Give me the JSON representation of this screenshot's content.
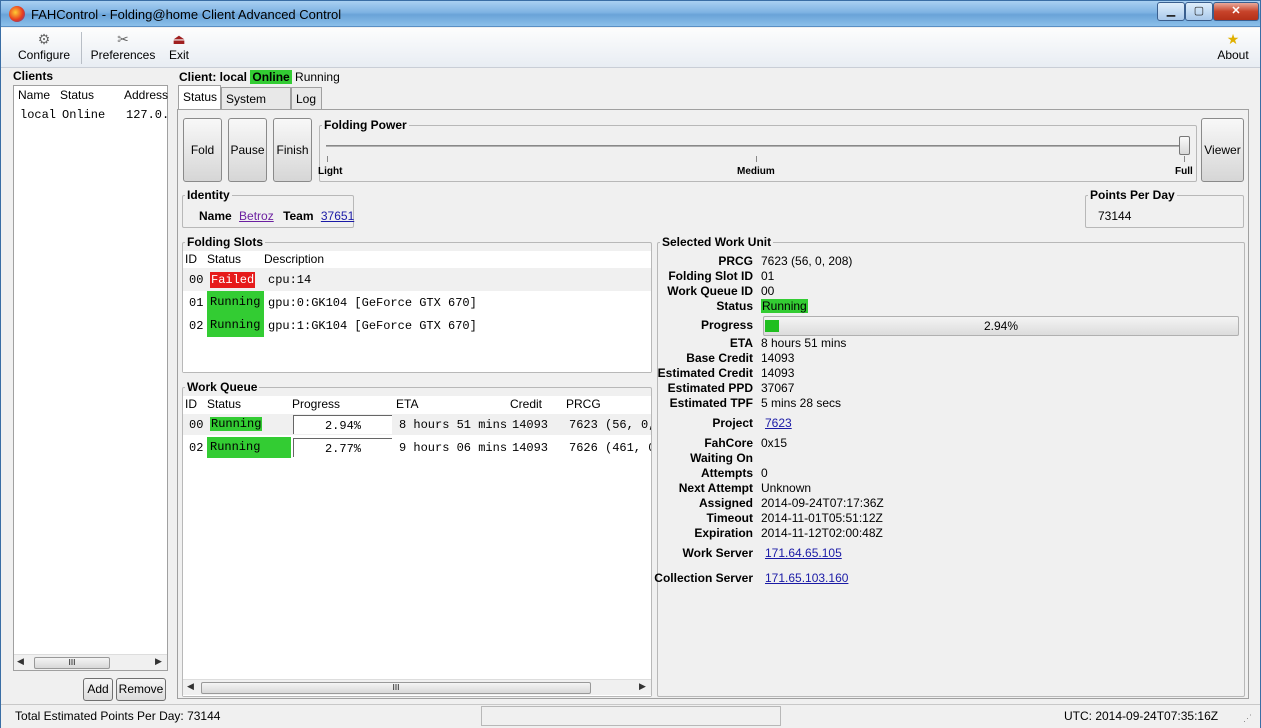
{
  "window": {
    "title": "FAHControl - Folding@home Client Advanced Control",
    "min_glyph": "▁",
    "max_glyph": "▢",
    "close_glyph": "✕"
  },
  "toolbar": {
    "configure": "Configure",
    "preferences": "Preferences",
    "exit": "Exit",
    "about": "About"
  },
  "clients": {
    "label": "Clients",
    "columns": [
      "Name",
      "Status",
      "Address"
    ],
    "rows": [
      {
        "name": "local",
        "status": "Online",
        "address": "127.0."
      }
    ],
    "scroll_glyph": "III",
    "add": "Add",
    "remove": "Remove"
  },
  "client_header": {
    "prefix": "Client: local",
    "online": "Online",
    "status": "Running"
  },
  "tabs": [
    "Status",
    "System Info",
    "Log"
  ],
  "controls": {
    "fold": "Fold",
    "pause": "Pause",
    "finish": "Finish",
    "viewer": "Viewer",
    "folding_power_label": "Folding Power",
    "light": "Light",
    "medium": "Medium",
    "full": "Full",
    "power_level": 1.0
  },
  "identity": {
    "label": "Identity",
    "name_label": "Name",
    "name": "Betroz",
    "team_label": "Team",
    "team": "37651"
  },
  "ppd": {
    "label": "Points Per Day",
    "value": "73144"
  },
  "folding_slots": {
    "label": "Folding Slots",
    "columns": [
      "ID",
      "Status",
      "Description"
    ],
    "rows": [
      {
        "id": "00",
        "status": "Failed",
        "desc": "cpu:14"
      },
      {
        "id": "01",
        "status": "Running",
        "desc": "gpu:0:GK104 [GeForce GTX 670]"
      },
      {
        "id": "02",
        "status": "Running",
        "desc": "gpu:1:GK104 [GeForce GTX 670]"
      }
    ]
  },
  "work_queue": {
    "label": "Work Queue",
    "columns": [
      "ID",
      "Status",
      "Progress",
      "ETA",
      "Credit",
      "PRCG"
    ],
    "rows": [
      {
        "id": "00",
        "status": "Running",
        "progress": "2.94%",
        "eta": "8 hours 51 mins",
        "credit": "14093",
        "prcg": "7623 (56, 0,"
      },
      {
        "id": "02",
        "status": "Running",
        "progress": "2.77%",
        "eta": "9 hours 06 mins",
        "credit": "14093",
        "prcg": "7626 (461, 0"
      }
    ],
    "scroll_glyph": "III"
  },
  "selected_wu": {
    "label": "Selected Work Unit",
    "prcg_label": "PRCG",
    "prcg": "7623 (56, 0, 208)",
    "slot_label": "Folding Slot ID",
    "slot": "01",
    "queue_label": "Work Queue ID",
    "queue": "00",
    "status_label": "Status",
    "status": "Running",
    "progress_label": "Progress",
    "progress": "2.94%",
    "progress_fraction": 0.0294,
    "eta_label": "ETA",
    "eta": "8 hours 51 mins",
    "base_credit_label": "Base Credit",
    "base_credit": "14093",
    "est_credit_label": "Estimated Credit",
    "est_credit": "14093",
    "est_ppd_label": "Estimated PPD",
    "est_ppd": "37067",
    "est_tpf_label": "Estimated TPF",
    "est_tpf": "5 mins 28 secs",
    "project_label": "Project",
    "project": "7623",
    "fahcore_label": "FahCore",
    "fahcore": "0x15",
    "waiting_label": "Waiting On",
    "waiting": "",
    "attempts_label": "Attempts",
    "attempts": "0",
    "next_attempt_label": "Next Attempt",
    "next_attempt": "Unknown",
    "assigned_label": "Assigned",
    "assigned": "2014-09-24T07:17:36Z",
    "timeout_label": "Timeout",
    "timeout": "2014-11-01T05:51:12Z",
    "expiration_label": "Expiration",
    "expiration": "2014-11-12T02:00:48Z",
    "work_server_label": "Work Server",
    "work_server": "171.64.65.105",
    "collection_server_label": "Collection Server",
    "collection_server": "171.65.103.160"
  },
  "statusbar": {
    "total_ppd": "Total Estimated Points Per Day: 73144",
    "utc": "UTC: 2014-09-24T07:35:16Z"
  }
}
